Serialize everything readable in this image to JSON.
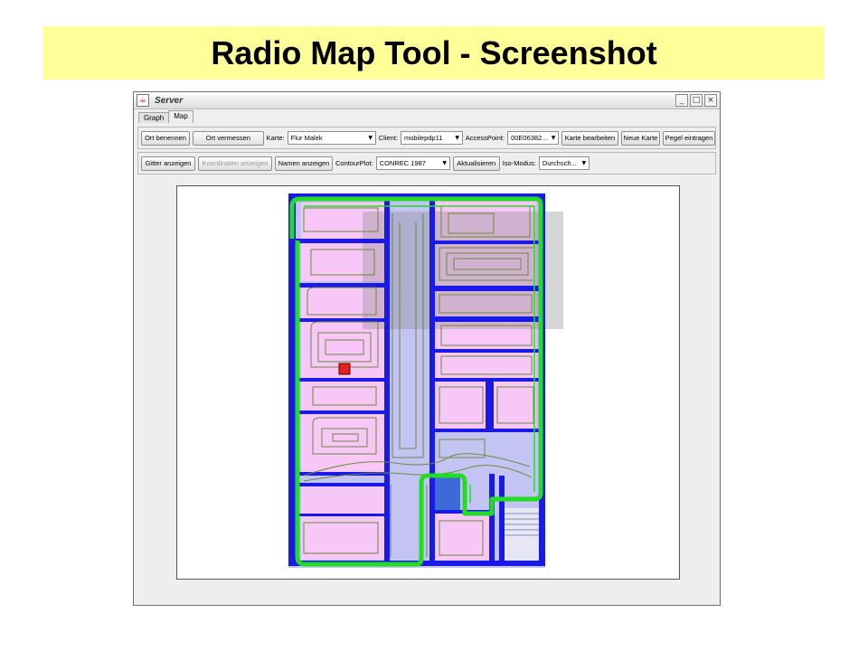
{
  "slide": {
    "title": "Radio Map Tool - Screenshot"
  },
  "window": {
    "title": "Server",
    "icon": "java-icon",
    "controls": [
      "minimize-icon",
      "maximize-icon",
      "close-icon"
    ]
  },
  "tabs": [
    {
      "label": "Graph",
      "active": false
    },
    {
      "label": "Map",
      "active": true
    }
  ],
  "toolbar1": {
    "ort_benennen": "Ort benennen",
    "ort_vermessen": "Ort vermessen",
    "karte_label": "Karte:",
    "karte_value": "Flur Malek",
    "client_label": "Client:",
    "client_value": "mobilepdp11",
    "accesspoint_label": "AccessPoint:",
    "accesspoint_value": "00E06382...",
    "karte_bearbeiten": "Karte bearbeiten",
    "neue_karte": "Neue Karte",
    "pegel_eintragen": "Pegel eintragen"
  },
  "toolbar2": {
    "gitter_anzeigen": "Gitter anzeigen",
    "koordinaten_anzeigen": "Koordinaten anzeigen",
    "namen_anzeigen": "Namen anzeigen",
    "contourplot_label": "ContourPlot:",
    "contourplot_value": "CONREC 1987",
    "aktualisieren": "Aktualisieren",
    "isomodus_label": "Iso-Modus:",
    "isomodus_value": "Durchsch..."
  },
  "colors": {
    "room_fill": "#f7c8f7",
    "corridor_fill": "#c4c4f4",
    "wall": "#1a1ae6",
    "contour": "#6b8a3a",
    "signal_outline": "#22dd22",
    "marker": "#e02020"
  }
}
